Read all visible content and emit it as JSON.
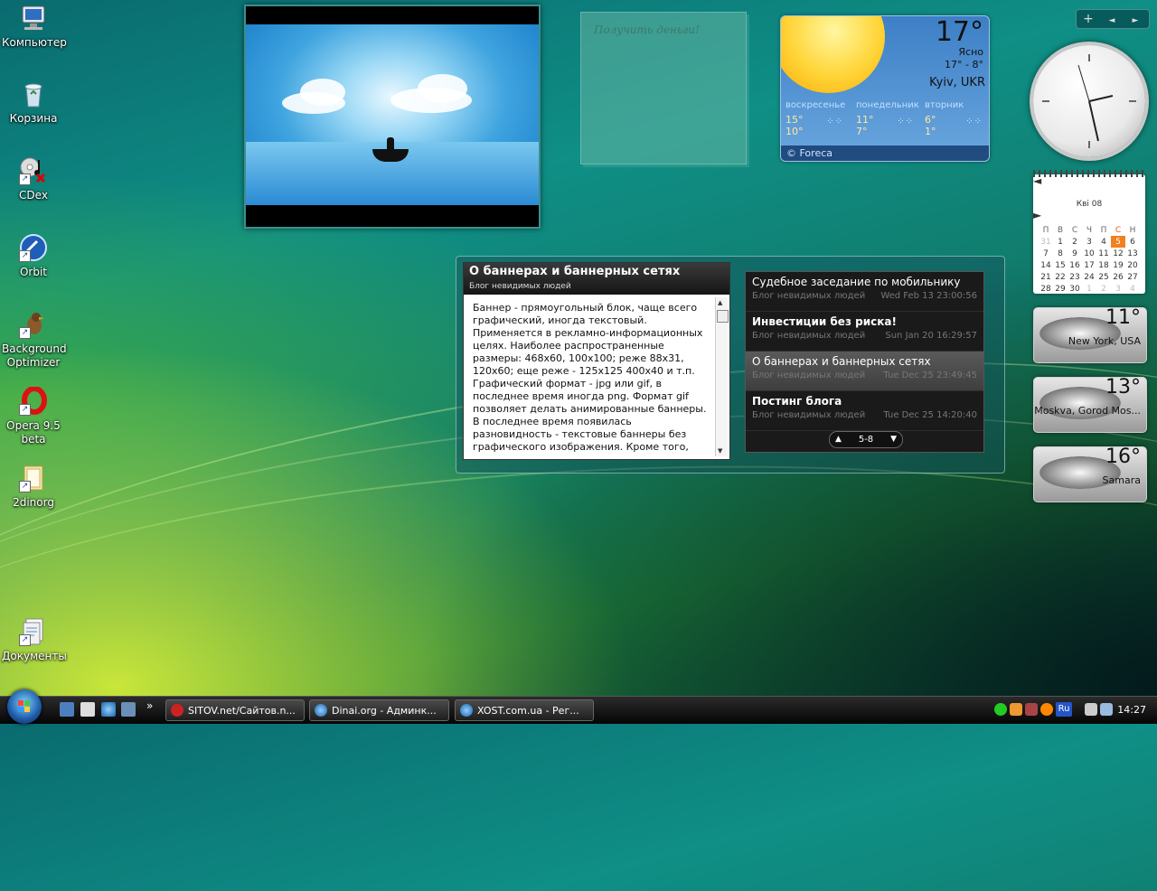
{
  "desktop_icons": [
    {
      "label": "Компьютер",
      "icon": "computer-icon"
    },
    {
      "label": "Корзина",
      "icon": "recycle-bin-icon"
    },
    {
      "label": "CDex",
      "icon": "cdex-icon"
    },
    {
      "label": "Orbit",
      "icon": "orbit-icon"
    },
    {
      "label": "Background Optimizer",
      "icon": "bird-icon"
    },
    {
      "label": "Opera 9.5 beta",
      "icon": "opera-icon"
    },
    {
      "label": "2dinorg",
      "icon": "folder-icon"
    },
    {
      "label": "Документы",
      "icon": "documents-icon"
    }
  ],
  "notes": {
    "text": "Получить деньги!"
  },
  "weather": {
    "temp": "17°",
    "condition": "Ясно",
    "range": "17° -   8°",
    "city": "Kyiv, UKR",
    "forecast": [
      {
        "day": "воскресенье",
        "hi": "15°",
        "lo": "10°"
      },
      {
        "day": "понедельник",
        "hi": "11°",
        "lo": "7°"
      },
      {
        "day": "вторник",
        "hi": "6°",
        "lo": "1°"
      }
    ],
    "footer": "© Foreca"
  },
  "gadget_bar": {
    "add": "+",
    "prev": "◄",
    "next": "►"
  },
  "calendar": {
    "month": "Квi 08",
    "weekdays": [
      "П",
      "В",
      "С",
      "Ч",
      "П",
      "С",
      "Н"
    ],
    "rows": [
      [
        "31",
        "1",
        "2",
        "3",
        "4",
        "5",
        "6"
      ],
      [
        "7",
        "8",
        "9",
        "10",
        "11",
        "12",
        "13"
      ],
      [
        "14",
        "15",
        "16",
        "17",
        "18",
        "19",
        "20"
      ],
      [
        "21",
        "22",
        "23",
        "24",
        "25",
        "26",
        "27"
      ],
      [
        "28",
        "29",
        "30",
        "1",
        "2",
        "3",
        "4"
      ]
    ],
    "today": "5"
  },
  "mini_weather": [
    {
      "temp": "11°",
      "city": "New York, USA"
    },
    {
      "temp": "13°",
      "city": "Moskva, Gorod Mos..."
    },
    {
      "temp": "16°",
      "city": "Samara"
    }
  ],
  "rss": {
    "article_title": "О баннерах и баннерных сетях",
    "article_source": "Блог невидимых людей",
    "article_body": "Баннер - прямоугольный блок, чаще всего графический, иногда текстовый. Применяется в рекламно-информационных целях. Наиболее распространенные размеры: 468x60, 100x100; реже 88x31, 120x60; еще реже - 125x125 400x40 и т.п. Графический формат - jpg или gif, в последнее время иногда png. Формат gif позволяет делать анимированные баннеры. В последнее время появилась разновидность - текстовые баннеры без графического изображения. Кроме того,",
    "items": [
      {
        "title": "Судебное заседание по мобильнику",
        "source": "Блог невидимых людей",
        "date": "Wed Feb 13 23:00:56"
      },
      {
        "title": "Инвестиции без риска!",
        "source": "Блог невидимых людей",
        "date": "Sun Jan 20 16:29:57"
      },
      {
        "title": "О баннерах и баннерных сетях",
        "source": "Блог невидимых людей",
        "date": "Tue Dec 25 23:49:45"
      },
      {
        "title": "Постинг блога",
        "source": "Блог невидимых людей",
        "date": "Tue Dec 25 14:20:40"
      }
    ],
    "pager": "5-8"
  },
  "taskbar": {
    "tasks": [
      {
        "label": "SITOV.net/Сайтов.n..."
      },
      {
        "label": "Dinai.org - Админк..."
      },
      {
        "label": "XOST.com.ua - Рег..."
      }
    ],
    "chevron": "»",
    "lang": "Ru",
    "time": "14:27"
  }
}
